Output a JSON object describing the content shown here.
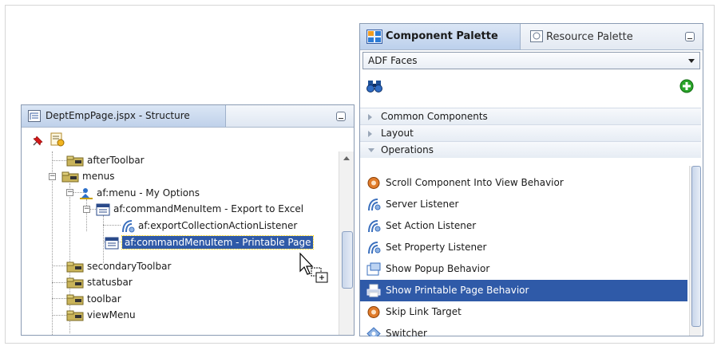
{
  "structure_panel": {
    "title": "DeptEmpPage.jspx - Structure",
    "tree": [
      {
        "label": "afterToolbar",
        "icon": "folder-icon"
      },
      {
        "label": "menus",
        "icon": "folder-icon"
      },
      {
        "label": "af:menu - My Options",
        "icon": "menu-icon"
      },
      {
        "label": "af:commandMenuItem - Export to Excel",
        "icon": "command-menu-item-icon"
      },
      {
        "label": "af:exportCollectionActionListener",
        "icon": "listener-icon"
      },
      {
        "label": "af:commandMenuItem - Printable Page",
        "icon": "command-menu-item-icon",
        "selected": true
      },
      {
        "label": "secondaryToolbar",
        "icon": "folder-icon"
      },
      {
        "label": "statusbar",
        "icon": "folder-icon"
      },
      {
        "label": "toolbar",
        "icon": "folder-icon"
      },
      {
        "label": "viewMenu",
        "icon": "folder-icon"
      }
    ]
  },
  "component_palette": {
    "tabs": [
      {
        "label": "Component Palette",
        "active": true
      },
      {
        "label": "Resource Palette",
        "active": false
      }
    ],
    "library_select": "ADF Faces",
    "categories": [
      {
        "label": "Common Components",
        "expanded": false
      },
      {
        "label": "Layout",
        "expanded": false
      },
      {
        "label": "Operations",
        "expanded": true
      }
    ],
    "items": [
      {
        "label": "Scroll Component Into View Behavior",
        "icon": "behavior-icon"
      },
      {
        "label": "Server Listener",
        "icon": "listener-icon"
      },
      {
        "label": "Set Action Listener",
        "icon": "listener-icon"
      },
      {
        "label": "Set Property Listener",
        "icon": "listener-icon"
      },
      {
        "label": "Show Popup Behavior",
        "icon": "popup-icon"
      },
      {
        "label": "Show Printable Page Behavior",
        "icon": "printer-icon",
        "selected": true
      },
      {
        "label": "Skip Link Target",
        "icon": "behavior-icon"
      },
      {
        "label": "Switcher",
        "icon": "switcher-icon"
      }
    ]
  },
  "colors": {
    "selection": "#2f5aa8",
    "panel_header": "#dbe6f5",
    "border": "#8a9bb3"
  }
}
